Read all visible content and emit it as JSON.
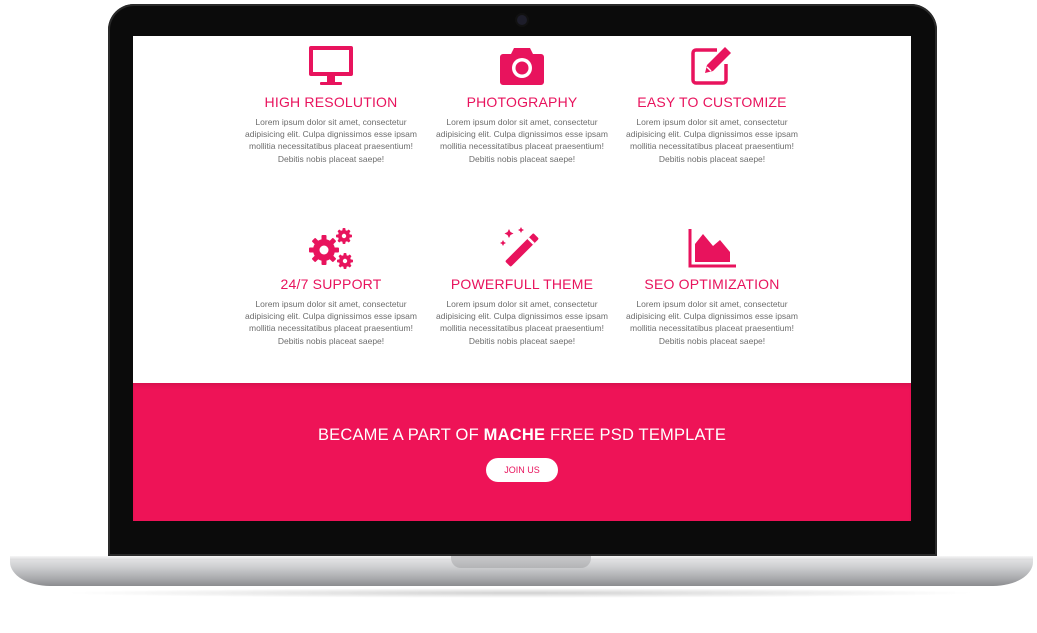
{
  "features": [
    {
      "icon": "monitor-icon",
      "title": "HIGH RESOLUTION",
      "text": "Lorem ipsum dolor sit amet, consectetur adipisicing elit. Culpa dignissimos esse ipsam mollitia necessitatibus placeat praesentium! Debitis nobis placeat saepe!"
    },
    {
      "icon": "camera-icon",
      "title": "PHOTOGRAPHY",
      "text": "Lorem ipsum dolor sit amet, consectetur adipisicing elit. Culpa dignissimos esse ipsam mollitia necessitatibus placeat praesentium! Debitis nobis placeat saepe!"
    },
    {
      "icon": "edit-icon",
      "title": "EASY TO CUSTOMIZE",
      "text": "Lorem ipsum dolor sit amet, consectetur adipisicing elit. Culpa dignissimos esse ipsam mollitia necessitatibus placeat praesentium! Debitis nobis placeat saepe!"
    },
    {
      "icon": "gears-icon",
      "title": "24/7 SUPPORT",
      "text": "Lorem ipsum dolor sit amet, consectetur adipisicing elit. Culpa dignissimos esse ipsam mollitia necessitatibus placeat praesentium! Debitis nobis placeat saepe!"
    },
    {
      "icon": "magic-wand-icon",
      "title": "POWERFULL THEME",
      "text": "Lorem ipsum dolor sit amet, consectetur adipisicing elit. Culpa dignissimos esse ipsam mollitia necessitatibus placeat praesentium! Debitis nobis placeat saepe!"
    },
    {
      "icon": "area-chart-icon",
      "title": "SEO OPTIMIZATION",
      "text": "Lorem ipsum dolor sit amet, consectetur adipisicing elit. Culpa dignissimos esse ipsam mollitia necessitatibus placeat praesentium! Debitis nobis placeat saepe!"
    }
  ],
  "cta": {
    "title_before": "BECAME A PART OF ",
    "title_brand": "MACHE",
    "title_after": " FREE PSD TEMPLATE",
    "button_label": "JOIN US"
  },
  "colors": {
    "accent": "#e8135d",
    "banner": "#ee1357",
    "text": "#6d6d6d"
  }
}
